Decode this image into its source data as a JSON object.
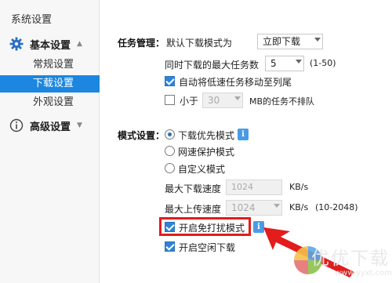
{
  "app": {
    "title": "系统设置"
  },
  "sidebar": {
    "groups": [
      {
        "label": "基本设置",
        "icon": "gear-icon",
        "chevron": "▲",
        "items": [
          {
            "label": "常规设置",
            "active": false
          },
          {
            "label": "下载设置",
            "active": true
          },
          {
            "label": "外观设置",
            "active": false
          }
        ]
      },
      {
        "label": "高级设置",
        "icon": "info-circle-icon",
        "chevron": "▼"
      }
    ]
  },
  "task_management": {
    "title": "任务管理：",
    "default_mode_label": "默认下载模式为",
    "default_mode_value": "立即下载",
    "max_tasks_label": "同时下载的最大任务数",
    "max_tasks_value": "5",
    "max_tasks_range": "(1-50)",
    "move_slow_label": "自动将低速任务移动至列尾",
    "move_slow_checked": true,
    "less_than_label": "小于",
    "less_than_checked": false,
    "less_than_value": "30",
    "less_than_suffix": "MB的任务不排队"
  },
  "mode_settings": {
    "title": "模式设置：",
    "options": [
      {
        "label": "下载优先模式",
        "selected": true
      },
      {
        "label": "网速保护模式",
        "selected": false
      },
      {
        "label": "自定义模式",
        "selected": false
      }
    ],
    "max_download_label": "最大下载速度",
    "max_download_value": "1024",
    "max_download_unit": "KB/s",
    "max_upload_label": "最大上传速度",
    "max_upload_value": "1024",
    "max_upload_unit": "KB/s",
    "max_upload_range": "(10-2048)",
    "dnd_label": "开启免打扰模式",
    "dnd_checked": true,
    "idle_label": "开启空闲下载",
    "idle_checked": true
  },
  "watermark": {
    "text": "优优下载",
    "url": "www.yyxt.com"
  },
  "colors": {
    "accent": "#1c86e0",
    "highlight": "#e31c1c"
  }
}
